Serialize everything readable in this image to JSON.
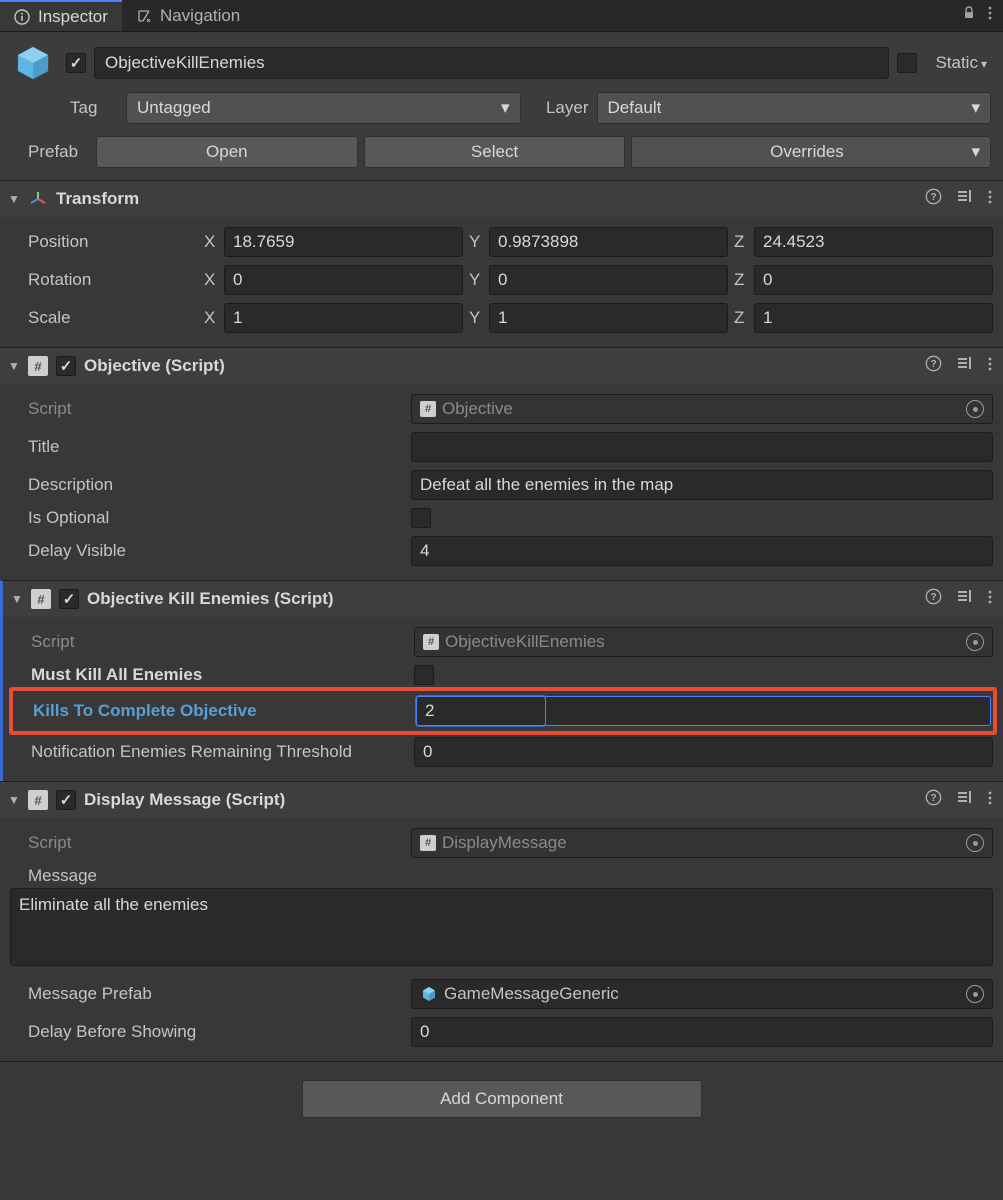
{
  "tabs": {
    "inspector": "Inspector",
    "navigation": "Navigation"
  },
  "header": {
    "name": "ObjectiveKillEnemies",
    "enabled": true,
    "static_label": "Static",
    "tag_label": "Tag",
    "tag_value": "Untagged",
    "layer_label": "Layer",
    "layer_value": "Default",
    "prefab_label": "Prefab",
    "prefab_open": "Open",
    "prefab_select": "Select",
    "prefab_overrides": "Overrides"
  },
  "transform": {
    "title": "Transform",
    "position_label": "Position",
    "rotation_label": "Rotation",
    "scale_label": "Scale",
    "x_label": "X",
    "y_label": "Y",
    "z_label": "Z",
    "position": {
      "x": "18.7659",
      "y": "0.9873898",
      "z": "24.4523"
    },
    "rotation": {
      "x": "0",
      "y": "0",
      "z": "0"
    },
    "scale": {
      "x": "1",
      "y": "1",
      "z": "1"
    }
  },
  "objective": {
    "title": "Objective (Script)",
    "enabled": true,
    "script_label": "Script",
    "script_value": "Objective",
    "title_label": "Title",
    "title_value": "",
    "description_label": "Description",
    "description_value": "Defeat all the enemies in the map",
    "is_optional_label": "Is Optional",
    "is_optional": false,
    "delay_visible_label": "Delay Visible",
    "delay_visible": "4"
  },
  "kill_enemies": {
    "title": "Objective Kill Enemies (Script)",
    "enabled": true,
    "script_label": "Script",
    "script_value": "ObjectiveKillEnemies",
    "must_kill_label": "Must Kill All Enemies",
    "must_kill": false,
    "kills_label": "Kills To Complete Objective",
    "kills_value": "2",
    "notif_label": "Notification Enemies Remaining Threshold",
    "notif_value": "0"
  },
  "display_message": {
    "title": "Display Message (Script)",
    "enabled": true,
    "script_label": "Script",
    "script_value": "DisplayMessage",
    "message_label": "Message",
    "message_value": "Eliminate all the enemies",
    "prefab_label": "Message Prefab",
    "prefab_value": "GameMessageGeneric",
    "delay_label": "Delay Before Showing",
    "delay_value": "0"
  },
  "add_component": "Add Component",
  "icons": {
    "hash": "#",
    "help": "?"
  }
}
